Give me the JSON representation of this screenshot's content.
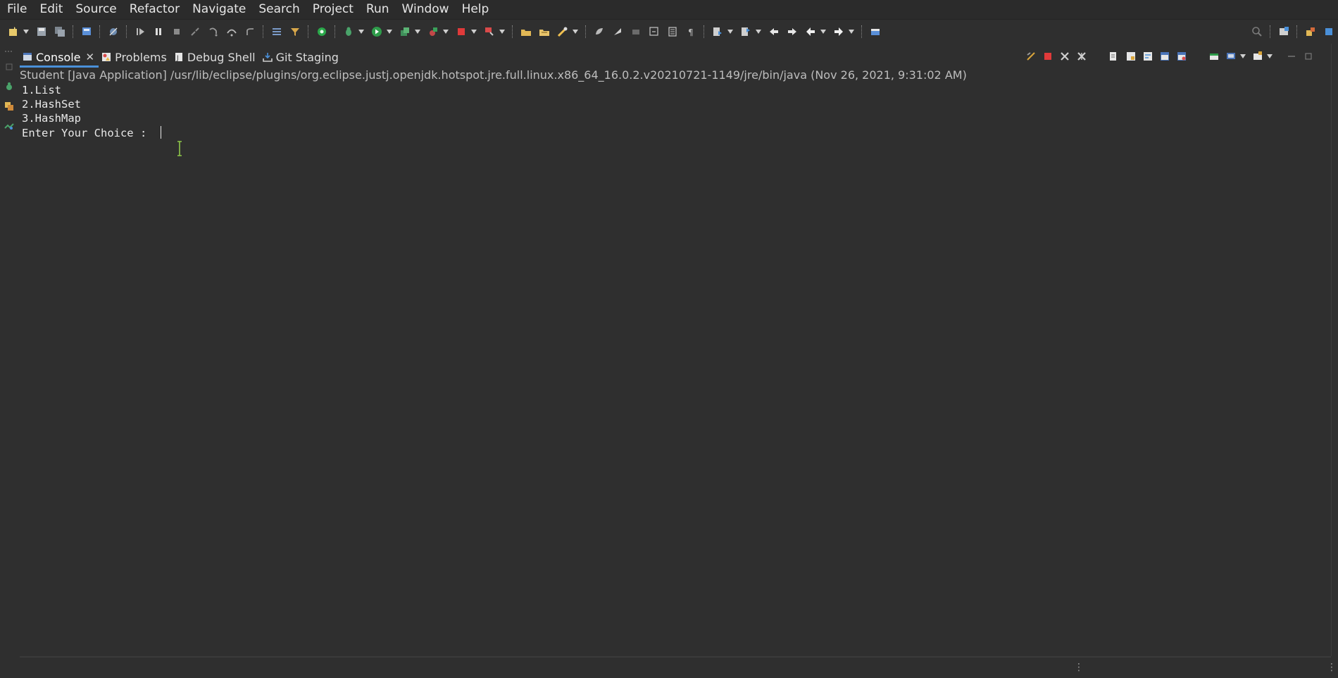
{
  "menu": [
    "File",
    "Edit",
    "Source",
    "Refactor",
    "Navigate",
    "Search",
    "Project",
    "Run",
    "Window",
    "Help"
  ],
  "toolbar_icons": [
    "new-icon",
    "save-icon",
    "save-all-icon",
    "debug-perspective-icon",
    "skip-breakpoints-icon",
    "resume-icon",
    "suspend-icon",
    "terminate-icon",
    "disconnect-icon",
    "step-into-icon",
    "step-over-icon",
    "step-return-icon",
    "drop-to-frame-icon",
    "use-step-filters-icon",
    "coverage-icon",
    "debug-icon",
    "run-icon",
    "run-last-tool-icon",
    "external-tools-icon",
    "stop-icon",
    "profile-icon",
    "open-type-icon",
    "open-task-icon",
    "search-icon",
    "toggle-mark-occurrences-icon",
    "toggle-word-wrap-icon",
    "toggle-block-selection-icon",
    "show-whitespace-icon",
    "next-annotation-icon",
    "previous-annotation-icon",
    "last-edit-location-icon",
    "back-icon",
    "forward-icon",
    "pin-editor-icon"
  ],
  "colors": {
    "accent": "#4a90d9",
    "background": "#2f2f2f",
    "text": "#dcdcdc",
    "terminate_red": "#e03a3a"
  },
  "tabs": [
    {
      "label": "Console",
      "icon": "console-icon",
      "active": true
    },
    {
      "label": "Problems",
      "icon": "problems-icon",
      "active": false
    },
    {
      "label": "Debug Shell",
      "icon": "debug-shell-icon",
      "active": false
    },
    {
      "label": "Git Staging",
      "icon": "git-staging-icon",
      "active": false
    }
  ],
  "console": {
    "header": "Student [Java Application] /usr/lib/eclipse/plugins/org.eclipse.justj.openjdk.hotspot.jre.full.linux.x86_64_16.0.2.v20210721-1149/jre/bin/java  (Nov 26, 2021, 9:31:02 AM)",
    "lines": [
      "1.List",
      "2.HashSet",
      "3.HashMap",
      "Enter Your Choice : "
    ]
  }
}
